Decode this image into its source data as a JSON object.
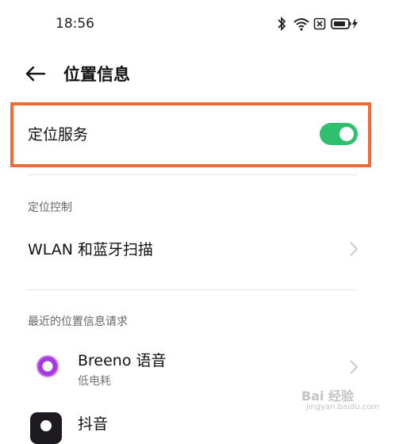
{
  "status_bar": {
    "time": "18:56",
    "icons": [
      "bluetooth-icon",
      "wifi-icon",
      "sim-icon",
      "battery-charging-icon"
    ]
  },
  "header": {
    "back_icon": "arrow-left-icon",
    "title": "位置信息"
  },
  "location_service": {
    "label": "定位服务",
    "enabled": true,
    "toggle_color": "#2ec06e",
    "highlight_color": "#f26a35"
  },
  "location_control": {
    "section_label": "定位控制",
    "wlan_bt_scan_label": "WLAN 和蓝牙扫描"
  },
  "recent_requests": {
    "section_label": "最近的位置信息请求",
    "apps": [
      {
        "name": "Breeno 语音",
        "sub": "低电耗",
        "icon": "breeno-icon"
      },
      {
        "name": "抖音",
        "sub": "",
        "icon": "douyin-icon"
      }
    ]
  },
  "watermark": {
    "text": "Bai 经验",
    "sub": "jingyan.baidu.com"
  }
}
